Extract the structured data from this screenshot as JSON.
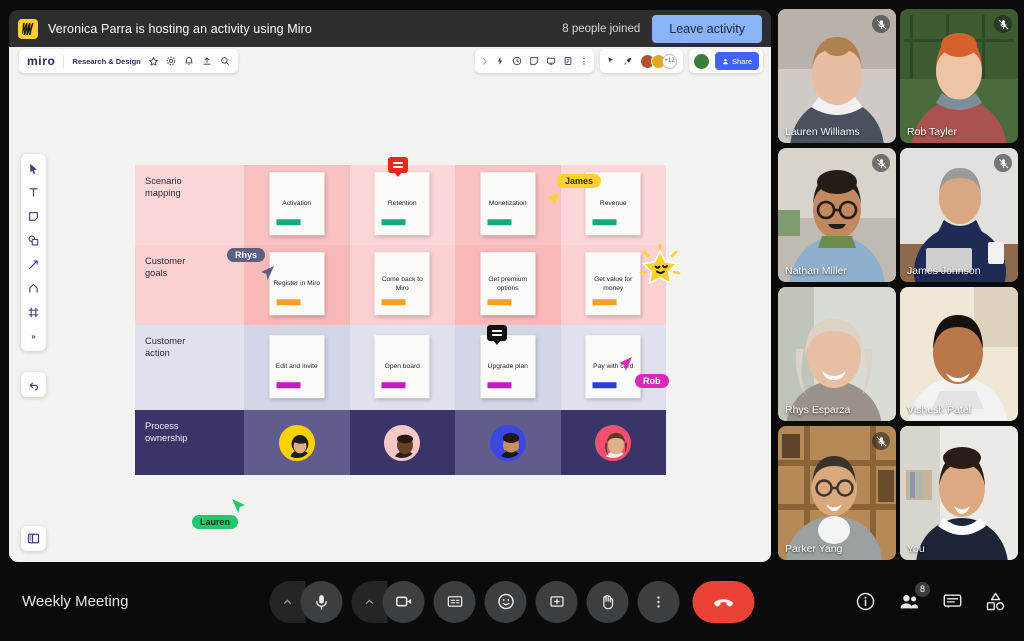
{
  "banner": {
    "logo_icon": "miro-logo-icon",
    "title": "Veronica Parra is hosting an activity using Miro",
    "joined": "8 people joined",
    "leave_label": "Leave activity"
  },
  "miro": {
    "wordmark": "miro",
    "board_name": "Research & Design",
    "header_icons": [
      "star-icon",
      "gear-icon",
      "bell-icon",
      "upload-icon",
      "search-icon"
    ],
    "tool_icons": [
      "expand-icon",
      "bolt-icon",
      "timer-icon",
      "sticky-note-icon",
      "present-icon",
      "card-icon",
      "more-icon"
    ],
    "right_tool_icons": [
      "cursor-share-icon",
      "rocket-icon"
    ],
    "avatar_more": "+12",
    "share_label": "Share",
    "left_tools": [
      "select-cursor-icon",
      "text-icon",
      "sticky-note-icon",
      "shapes-icon",
      "connector-icon",
      "pen-icon",
      "frame-icon",
      "more-tools-icon"
    ],
    "undo_icon": "undo-icon",
    "panel_toggle_icon": "panel-toggle-icon"
  },
  "board": {
    "rows": [
      {
        "label": "Scenario\nmapping",
        "label_line1": "Scenario",
        "label_line2": "mapping",
        "bar_color": "#17a97f",
        "cards": [
          "Activation",
          "Retention",
          "Monetization",
          "Revenue"
        ]
      },
      {
        "label_line1": "Customer",
        "label_line2": "goals",
        "bar_color": "#f5a020",
        "cards": [
          "Register in Miro",
          "Come back to Miro",
          "Get premium options",
          "Get value for money"
        ]
      },
      {
        "label_line1": "Customer",
        "label_line2": "action",
        "bar_color": "#c618c6",
        "cards": [
          "Edit and invite",
          "Open board",
          "Upgrade plan",
          "Pay with card"
        ]
      },
      {
        "label_line1": "Process",
        "label_line2": "ownership",
        "cards": [
          "",
          "",
          "",
          ""
        ]
      }
    ],
    "owner_avatar_colors": [
      "#ffd100",
      "#f6c8c8",
      "#3b47e0",
      "#f2506e"
    ],
    "pay_with_card_bar_color": "#2a3fd6",
    "cursors": [
      {
        "name": "James",
        "color": "#ffd02f",
        "text_color": "#32302a"
      },
      {
        "name": "Rhys",
        "color": "#5c6080",
        "text_color": "#ffffff"
      },
      {
        "name": "Rob",
        "color": "#d929b8",
        "text_color": "#ffffff"
      },
      {
        "name": "Lauren",
        "color": "#20c96b",
        "text_color": "#10321f"
      }
    ],
    "comment_icons": [
      {
        "name": "comment-badge-retention",
        "color": "#e8271f"
      },
      {
        "name": "comment-badge-upgrade-plan",
        "color": "#111111"
      }
    ],
    "star_sticker": "star-sticker-icon"
  },
  "participants": [
    {
      "name": "Lauren Williams",
      "muted": true,
      "self": false,
      "skin": "#e8bda2",
      "hair": "#b08050",
      "bg1": "#cfcac5",
      "bg2": "#b8b2ab",
      "shirt": "#47525e"
    },
    {
      "name": "Rob Tayler",
      "muted": true,
      "self": false,
      "skin": "#edc4a6",
      "hair": "#d4622a",
      "bg1": "#4a6b3c",
      "bg2": "#2f4a26",
      "shirt": "#a9524f"
    },
    {
      "name": "Nathan Miller",
      "muted": true,
      "self": false,
      "skin": "#c2895f",
      "hair": "#241c16",
      "bg1": "#d8d4cc",
      "bg2": "#c0bbb2",
      "shirt": "#8fb0cc"
    },
    {
      "name": "James Johnson",
      "muted": true,
      "self": false,
      "skin": "#d9a881",
      "hair": "#9a9a96",
      "bg1": "#e3e1dd",
      "bg2": "#cfccc7",
      "shirt": "#1f2a56"
    },
    {
      "name": "Rhys Esparza",
      "muted": false,
      "self": false,
      "skin": "#e6bfa4",
      "hair": "#ddd3c4",
      "bg1": "#d8dcd4",
      "bg2": "#bfc5ba",
      "shirt": "#9a9189"
    },
    {
      "name": "Vishesh Patel",
      "muted": false,
      "self": false,
      "skin": "#b9774a",
      "hair": "#17110d",
      "bg1": "#efe7d8",
      "bg2": "#ded2bd",
      "shirt": "#f2f2f2"
    },
    {
      "name": "Parker Yang",
      "muted": true,
      "self": false,
      "skin": "#d9a87c",
      "hair": "#3a332c",
      "bg1": "#b58a56",
      "bg2": "#8a6437",
      "shirt": "#9ba0a3"
    },
    {
      "name": "You",
      "muted": false,
      "self": true,
      "skin": "#dda982",
      "hair": "#2a1d16",
      "bg1": "#eceae6",
      "bg2": "#d8d4ce",
      "shirt": "#1d2539"
    }
  ],
  "bottom": {
    "meeting_name": "Weekly Meeting",
    "controls": [
      {
        "name": "mic-options-chevron",
        "icon": "chevron-up-icon"
      },
      {
        "name": "mic-button",
        "icon": "microphone-icon"
      },
      {
        "name": "camera-options-chevron",
        "icon": "chevron-up-icon"
      },
      {
        "name": "camera-button",
        "icon": "camera-icon"
      },
      {
        "name": "captions-button",
        "icon": "captions-icon"
      },
      {
        "name": "emoji-button",
        "icon": "emoji-icon"
      },
      {
        "name": "present-button",
        "icon": "present-screen-icon"
      },
      {
        "name": "raise-hand-button",
        "icon": "raise-hand-icon"
      },
      {
        "name": "more-options-button",
        "icon": "more-vertical-icon"
      },
      {
        "name": "hangup-button",
        "icon": "phone-hangup-icon"
      }
    ],
    "right_controls": [
      {
        "name": "meeting-details-button",
        "icon": "info-icon",
        "badge": ""
      },
      {
        "name": "people-button",
        "icon": "people-icon",
        "badge": "8"
      },
      {
        "name": "chat-button",
        "icon": "chat-icon",
        "badge": ""
      },
      {
        "name": "activities-button",
        "icon": "activities-icon",
        "badge": ""
      }
    ]
  }
}
